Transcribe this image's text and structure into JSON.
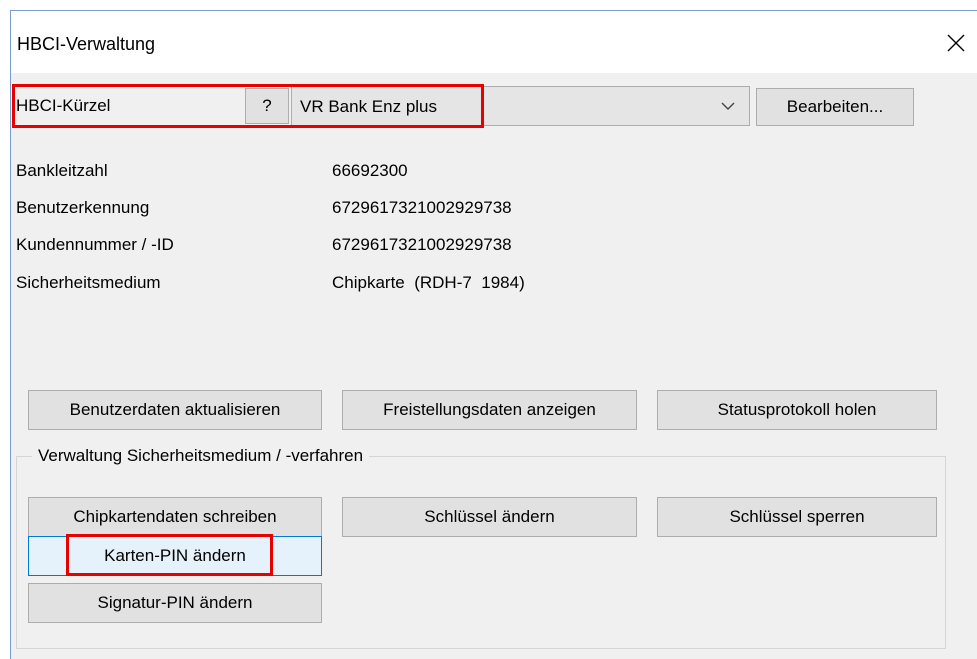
{
  "window": {
    "title": "HBCI-Verwaltung",
    "close_icon": "close-icon"
  },
  "selector": {
    "label": "HBCI-Kürzel",
    "help_label": "?",
    "combo_value": "VR Bank Enz plus",
    "edit_label": "Bearbeiten..."
  },
  "info": {
    "rows": [
      {
        "label": "Bankleitzahl",
        "value": "66692300"
      },
      {
        "label": "Benutzerkennung",
        "value": "6729617321002929738"
      },
      {
        "label": "Kundennummer / -ID",
        "value": "6729617321002929738"
      },
      {
        "label": "Sicherheitsmedium",
        "value": "Chipkarte  (RDH-7  1984)"
      }
    ]
  },
  "actions": {
    "update_user": "Benutzerdaten aktualisieren",
    "show_exemption": "Freistellungsdaten anzeigen",
    "get_status": "Statusprotokoll holen"
  },
  "security": {
    "group_title": "Verwaltung Sicherheitsmedium / -verfahren",
    "write_chip": "Chipkartendaten schreiben",
    "change_key": "Schlüssel ändern",
    "lock_key": "Schlüssel sperren",
    "change_card_pin": "Karten-PIN ändern",
    "change_signature_pin": "Signatur-PIN ändern"
  },
  "colors": {
    "highlight": "#e60000",
    "hot_button_border": "#0078d7",
    "dialog_background": "#f0f0f0"
  }
}
